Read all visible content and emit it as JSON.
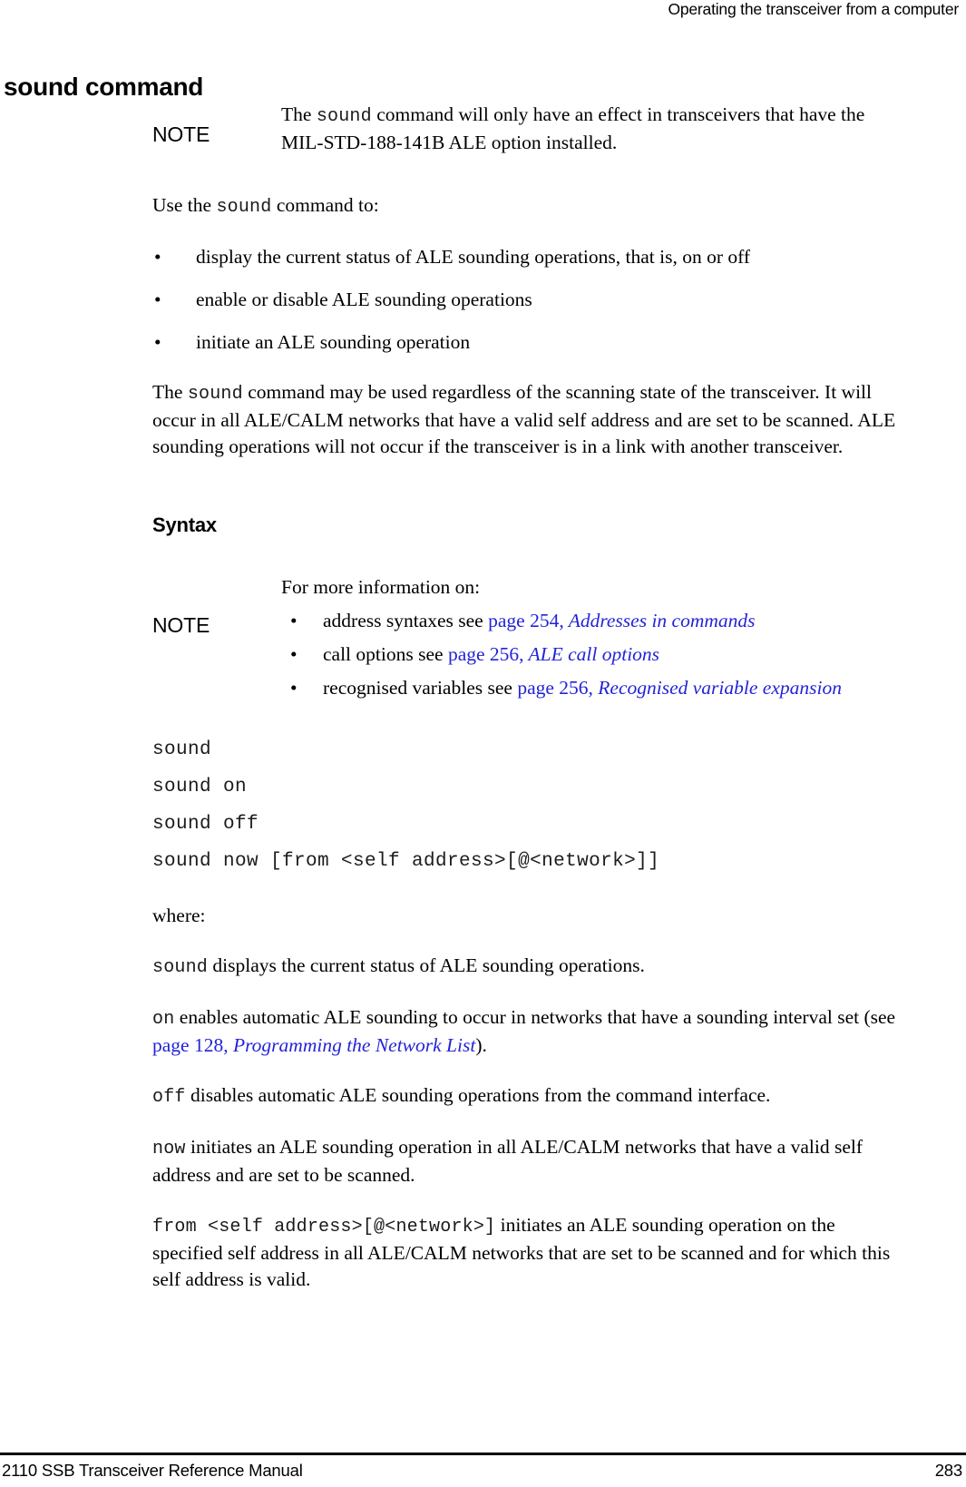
{
  "header": {
    "running_head": "Operating the transceiver from a computer"
  },
  "chapter": {
    "title": "sound command"
  },
  "note1": {
    "label": "NOTE",
    "text_part1": "The ",
    "code1": "sound",
    "text_part2": " command will only have an effect in transceivers that have the MIL-STD-188-141B ALE option installed."
  },
  "intro": {
    "lead_part1": "Use the ",
    "lead_code": "sound",
    "lead_part2": " command to:",
    "bullet_marker": "•",
    "bullets": [
      "display the current status of ALE sounding operations, that is, on or off",
      "enable or disable ALE sounding operations",
      "initiate an ALE sounding operation"
    ],
    "para_part1": "The ",
    "para_code": "sound",
    "para_part2": " command may be used regardless of the scanning state of the transceiver. It will occur in all ALE/CALM networks that have a valid self address and are set to be scanned. ALE sounding operations will not occur if the transceiver is in a link with another transceiver."
  },
  "syntax_section": {
    "heading": "Syntax"
  },
  "note2": {
    "label": "NOTE",
    "lead": "For more information on:",
    "bullet_marker": "•",
    "items": [
      {
        "text": "address syntaxes see ",
        "link": "page 254,",
        "link_italic": " Addresses in commands"
      },
      {
        "text": "call options see ",
        "link": "page 256,",
        "link_italic": " ALE call options"
      },
      {
        "text": "recognised variables see ",
        "link": "page 256,",
        "link_italic": " Recognised variable expansion"
      }
    ]
  },
  "syntax_lines": [
    "sound",
    "sound on",
    "sound off",
    "sound now [from <self address>[@<network>]]"
  ],
  "where": {
    "label": "where:",
    "entries": [
      {
        "code": "sound",
        "desc_part1": " displays the current status of ALE sounding operations.",
        "link": "",
        "link_italic": "",
        "desc_part2": ""
      },
      {
        "code": "on",
        "desc_part1": " enables automatic ALE sounding to occur in networks that have a sounding interval set (see ",
        "link": "page 128,",
        "link_italic": " Programming the Network List",
        "desc_part2": ")."
      },
      {
        "code": "off",
        "desc_part1": " disables automatic ALE sounding operations from the command interface.",
        "link": "",
        "link_italic": "",
        "desc_part2": ""
      },
      {
        "code": "now",
        "desc_part1": " initiates an ALE sounding operation in all ALE/CALM networks that have a valid self address and are set to be scanned.",
        "link": "",
        "link_italic": "",
        "desc_part2": ""
      },
      {
        "code": "from <self address>[@<network>]",
        "desc_part1": " initiates an ALE sounding operation on the specified self address in all ALE/CALM networks that are set to be scanned and for which this self address is valid.",
        "link": "",
        "link_italic": "",
        "desc_part2": ""
      }
    ]
  },
  "footer": {
    "manual_title": "2110 SSB Transceiver Reference Manual",
    "page_number": "283"
  },
  "colors": {
    "link": "#2323d8",
    "text": "#000000",
    "rule": "#000000"
  }
}
